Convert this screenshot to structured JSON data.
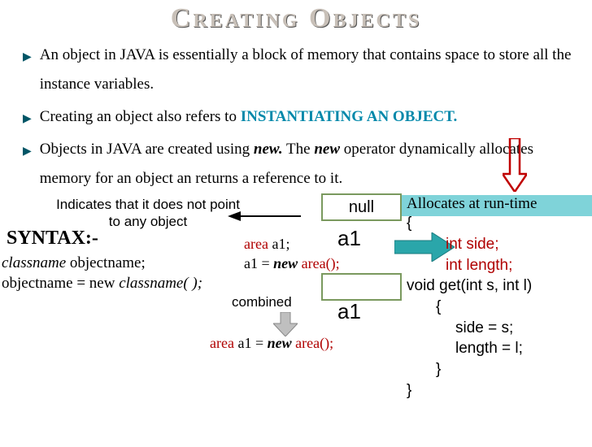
{
  "title": "Creating Objects",
  "bullets": {
    "b1": "An object in JAVA is essentially a block of memory that contains space to store all the instance variables.",
    "b2_pre": "Creating an object also refers to ",
    "b2_highlight": "INSTANTIATING AN OBJECT.",
    "b3_pre": "Objects in JAVA are created using ",
    "b3_new": "new.",
    "b3_mid": " The ",
    "b3_new2": "new",
    "b3_post": " operator dynamically allocates memory for an object an returns a reference to it."
  },
  "indicates": {
    "line1": "Indicates that it does not point",
    "line2": "to any object"
  },
  "null_label": "null",
  "allocates": "Allocates at run-time",
  "syntax_header": "SYNTAX:-",
  "syntax": {
    "line1_cn": "classname",
    "line1_on": "   objectname;",
    "line2_pre": "objectname  =  new   ",
    "line2_cn": "classname( );"
  },
  "a1": "a1",
  "code1": {
    "l1_area": "area",
    "l1_rest": " a1;",
    "l2_pre": "a1 = ",
    "l2_new": "new",
    "l2_area": " area();"
  },
  "combined": "combined",
  "code2": {
    "area1": "area",
    "mid": " a1 = ",
    "new": "new",
    "area2": " area();"
  },
  "class_code": {
    "brace_open": "{",
    "int_side": "int side;",
    "int_length": "int length;",
    "void_get": "void get(int s, int l)",
    "brace_open2": "{",
    "side_s": "side = s;",
    "len_l": "length =  l;",
    "brace_close2": "}",
    "brace_close": "}"
  }
}
